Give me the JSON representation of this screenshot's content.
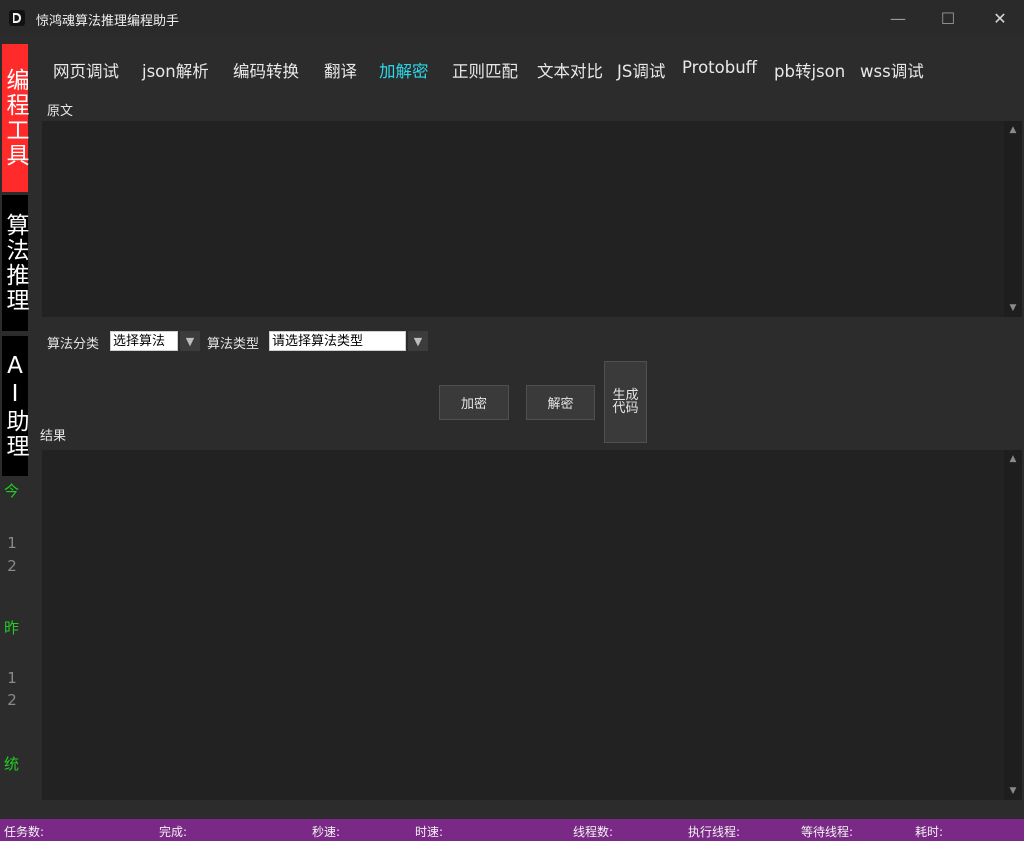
{
  "app": {
    "title": "惊鸿魂算法推理编程助手"
  },
  "window_controls": {
    "minimize": "—",
    "maximize": "☐",
    "close": "✕"
  },
  "sidebar": {
    "tool_tab": "编程工具",
    "algo_tab": "算法推理",
    "ai_tab": "AI助理",
    "today_label": "今日",
    "today_values": [
      "1",
      "2"
    ],
    "yesterday_label": "昨日",
    "yesterday_values": [
      "1",
      "2"
    ],
    "stats_label": "统计"
  },
  "tabs": [
    {
      "label": "网页调试"
    },
    {
      "label": "json解析"
    },
    {
      "label": "编码转换"
    },
    {
      "label": "翻译"
    },
    {
      "label": "加解密",
      "active": true
    },
    {
      "label": "正则匹配"
    },
    {
      "label": "文本对比"
    },
    {
      "label": "JS调试"
    },
    {
      "label": "Protobuff"
    },
    {
      "label": "pb转json"
    },
    {
      "label": "wss调试"
    }
  ],
  "source": {
    "label": "原文",
    "value": ""
  },
  "options": {
    "category_label": "算法分类",
    "category_value": "选择算法",
    "type_label": "算法类型",
    "type_value": "请选择算法类型"
  },
  "actions": {
    "encrypt": "加密",
    "decrypt": "解密",
    "generate": "生成\n代码"
  },
  "result": {
    "label": "结果",
    "value": ""
  },
  "status": {
    "tasks": "任务数:",
    "done": "完成:",
    "per_second": "秒速:",
    "per_hour": "时速:",
    "threads": "线程数:",
    "running_threads": "执行线程:",
    "waiting_threads": "等待线程:",
    "elapsed": "耗时:"
  },
  "colors": {
    "accent_tab": "#2bd8e8",
    "tool_tab_bg": "#ff2b2b",
    "stat_label": "#22cc22",
    "statusbar_bg": "#7a2a86"
  }
}
